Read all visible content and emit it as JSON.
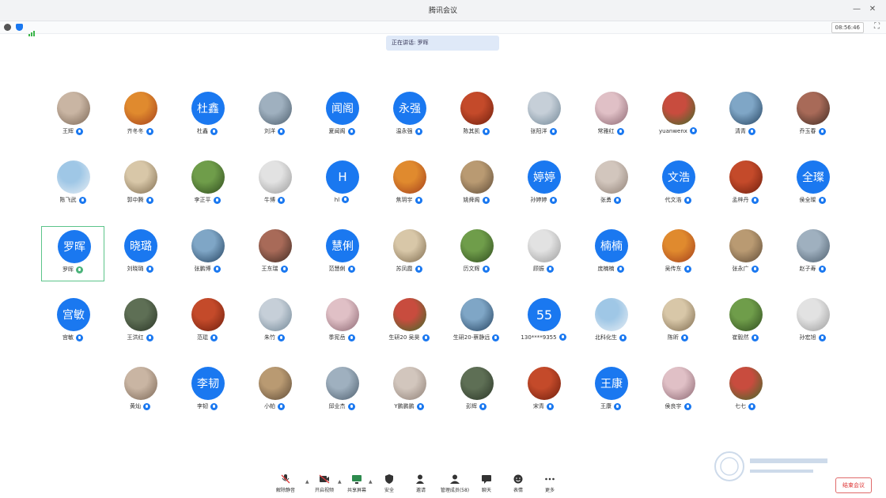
{
  "window": {
    "title": "腾讯会议"
  },
  "infobar": {
    "timer": "08:56:46"
  },
  "speaking_banner": "正在讲话: 罗晖",
  "participants": [
    {
      "name": "王辉",
      "avatar_text": ""
    },
    {
      "name": "齐冬冬",
      "avatar_text": ""
    },
    {
      "name": "杜鑫",
      "avatar_text": "杜鑫"
    },
    {
      "name": "刘洋",
      "avatar_text": ""
    },
    {
      "name": "夏闻阁",
      "avatar_text": "闻阁"
    },
    {
      "name": "温永强",
      "avatar_text": "永强"
    },
    {
      "name": "陈其凯",
      "avatar_text": ""
    },
    {
      "name": "张阳洋",
      "avatar_text": ""
    },
    {
      "name": "常雅红",
      "avatar_text": ""
    },
    {
      "name": "yuanwenx",
      "avatar_text": ""
    },
    {
      "name": "清青",
      "avatar_text": ""
    },
    {
      "name": "乔玉春",
      "avatar_text": ""
    },
    {
      "name": "陈飞武",
      "avatar_text": ""
    },
    {
      "name": "郭中腾",
      "avatar_text": ""
    },
    {
      "name": "李正平",
      "avatar_text": ""
    },
    {
      "name": "牛博",
      "avatar_text": ""
    },
    {
      "name": "hl",
      "avatar_text": "H"
    },
    {
      "name": "焦玥宇",
      "avatar_text": ""
    },
    {
      "name": "姚舜阁",
      "avatar_text": ""
    },
    {
      "name": "孙婷婷",
      "avatar_text": "婷婷"
    },
    {
      "name": "张勇",
      "avatar_text": ""
    },
    {
      "name": "代文浩",
      "avatar_text": "文浩"
    },
    {
      "name": "孟梓丹",
      "avatar_text": ""
    },
    {
      "name": "侯全璨",
      "avatar_text": "全璨"
    },
    {
      "name": "罗晖",
      "avatar_text": "罗晖"
    },
    {
      "name": "刘晓璐",
      "avatar_text": "晓璐"
    },
    {
      "name": "张鹏博",
      "avatar_text": ""
    },
    {
      "name": "王东瑞",
      "avatar_text": ""
    },
    {
      "name": "范慧俐",
      "avatar_text": "慧俐"
    },
    {
      "name": "苏凤霞",
      "avatar_text": ""
    },
    {
      "name": "历文辉",
      "avatar_text": ""
    },
    {
      "name": "顾振",
      "avatar_text": ""
    },
    {
      "name": "庞楠楠",
      "avatar_text": "楠楠"
    },
    {
      "name": "吴传东",
      "avatar_text": ""
    },
    {
      "name": "张永广",
      "avatar_text": ""
    },
    {
      "name": "赵子寿",
      "avatar_text": ""
    },
    {
      "name": "宫敏",
      "avatar_text": "宫敏"
    },
    {
      "name": "王洪红",
      "avatar_text": ""
    },
    {
      "name": "范琨",
      "avatar_text": ""
    },
    {
      "name": "朱竹",
      "avatar_text": ""
    },
    {
      "name": "季宪岳",
      "avatar_text": ""
    },
    {
      "name": "生研20 吴昊",
      "avatar_text": ""
    },
    {
      "name": "生研20-蔡静远",
      "avatar_text": ""
    },
    {
      "name": "130****9355",
      "avatar_text": "55"
    },
    {
      "name": "北科化生",
      "avatar_text": ""
    },
    {
      "name": "陈昕",
      "avatar_text": ""
    },
    {
      "name": "崔毅然",
      "avatar_text": ""
    },
    {
      "name": "孙宏旭",
      "avatar_text": ""
    },
    {
      "name": "黄灿",
      "avatar_text": ""
    },
    {
      "name": "李韧",
      "avatar_text": "李韧"
    },
    {
      "name": "小帕",
      "avatar_text": ""
    },
    {
      "name": "邱业杰",
      "avatar_text": ""
    },
    {
      "name": "Y鹏鹏鹏",
      "avatar_text": ""
    },
    {
      "name": "彭辉",
      "avatar_text": ""
    },
    {
      "name": "宋青",
      "avatar_text": ""
    },
    {
      "name": "王康",
      "avatar_text": "王康"
    },
    {
      "name": "侯良宇",
      "avatar_text": ""
    },
    {
      "name": "七七",
      "avatar_text": ""
    }
  ],
  "toolbar": {
    "unmute": "解除静音",
    "video": "开启视频",
    "share": "共享屏幕",
    "security": "安全",
    "invite": "邀请",
    "members": "管理成员(58)",
    "chat": "聊天",
    "reactions": "表情",
    "more": "更多",
    "end": "结束会议"
  },
  "colors": {
    "accent": "#1a78f0",
    "active_border": "#5cc48a",
    "end": "#d33333"
  }
}
